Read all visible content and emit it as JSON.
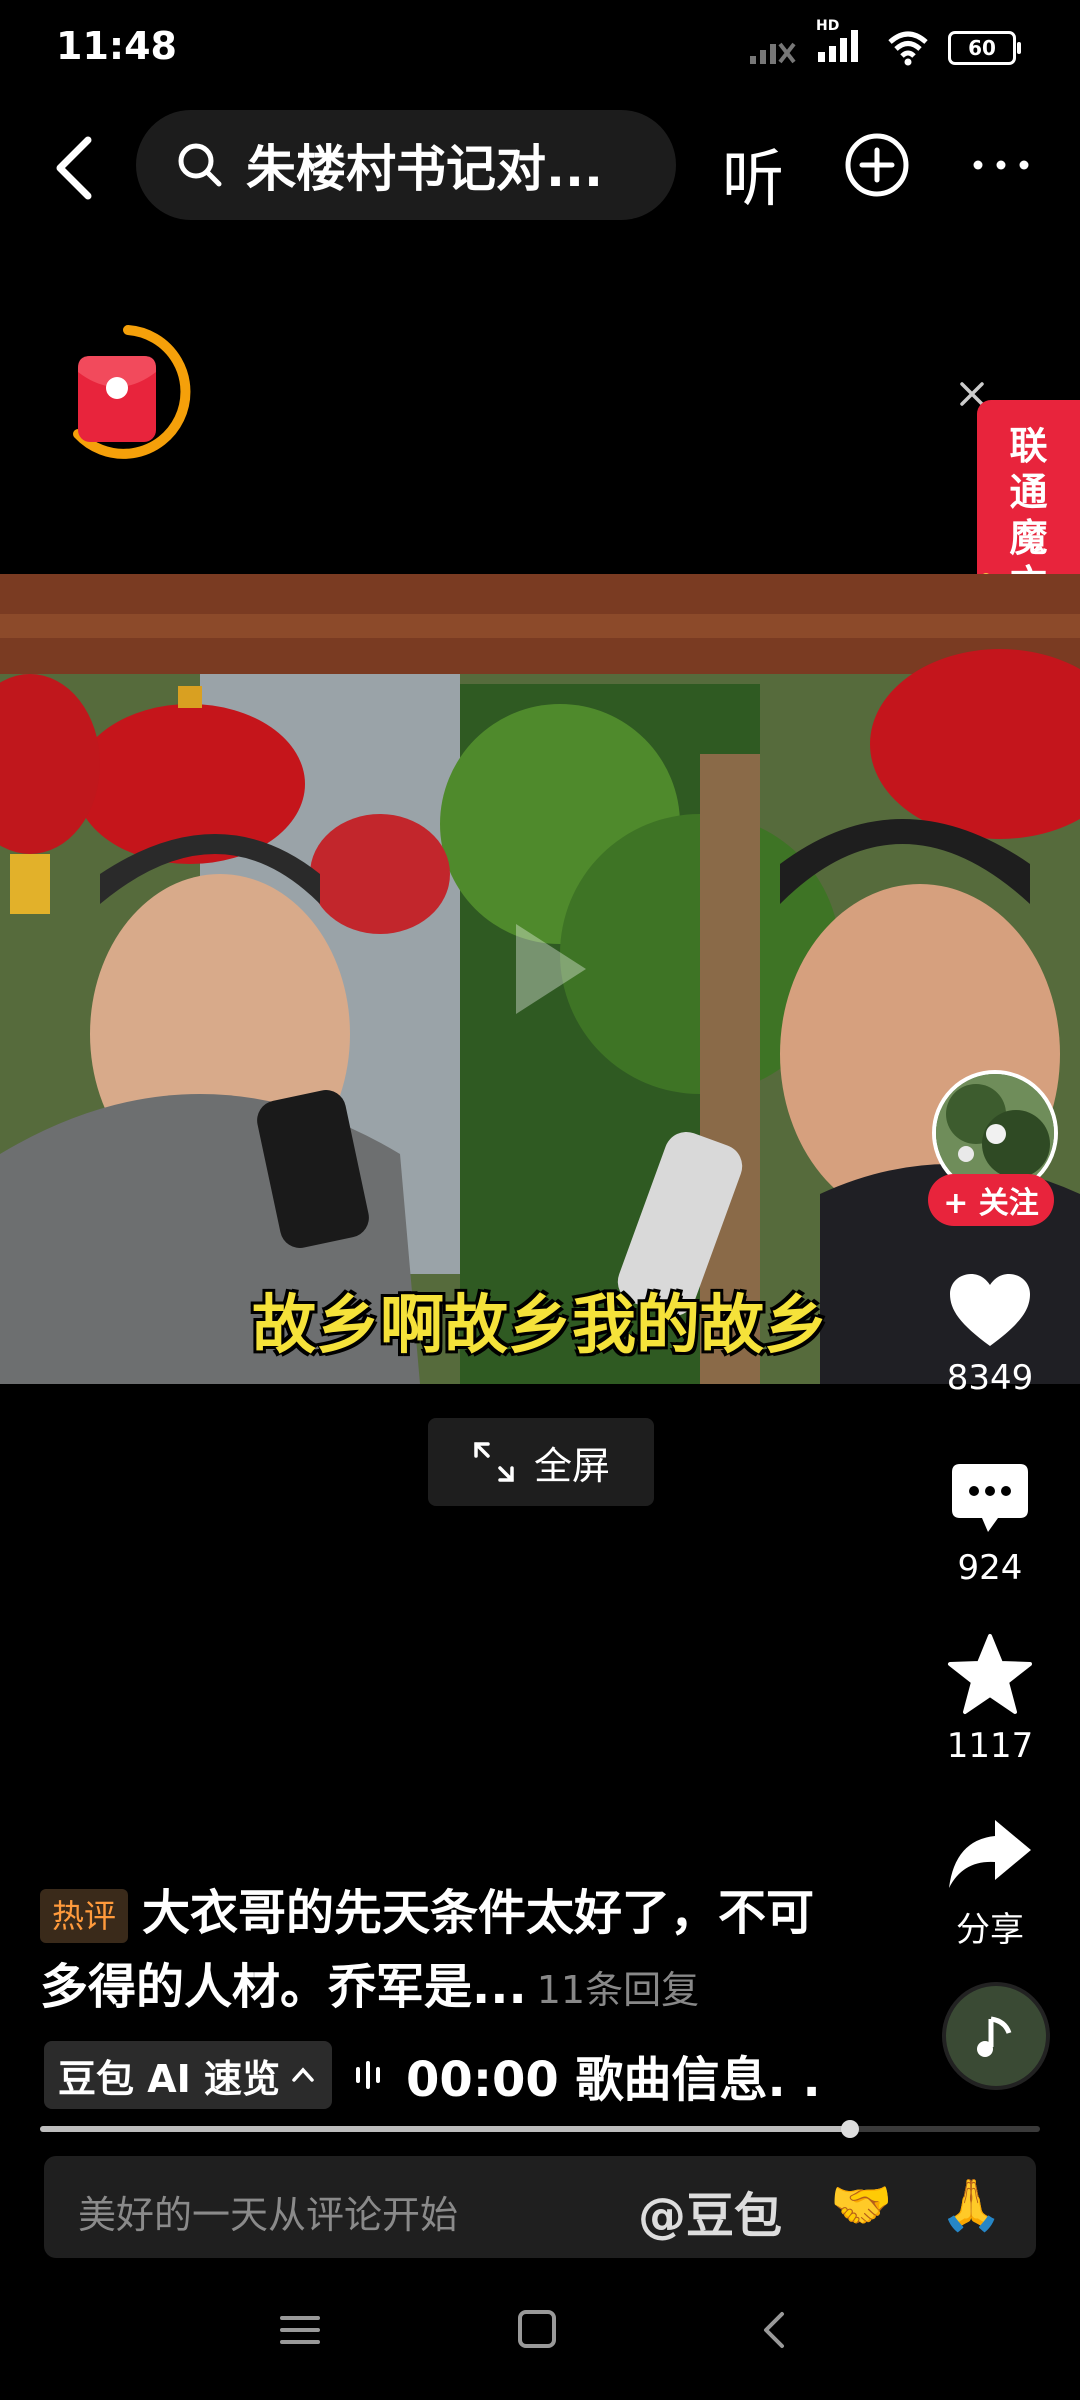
{
  "status_bar": {
    "time": "11:48",
    "battery": "60",
    "network_label": "HD"
  },
  "top_bar": {
    "search_query": "朱楼村书记对...",
    "listen_label": "听"
  },
  "ad": {
    "banner_chars": [
      "联",
      "通",
      "魔",
      "方"
    ]
  },
  "video": {
    "subtitle": "故乡啊故乡我的故乡"
  },
  "fullscreen_label": "全屏",
  "rail": {
    "follow_label": "+ 关注",
    "likes": "8349",
    "comments": "924",
    "favorites": "1117",
    "share_label": "分享"
  },
  "hot_comment": {
    "tag": "热评",
    "text": "大衣哥的先天条件太好了，不可多得的人材。乔军是...",
    "replies": "11条回复"
  },
  "ai_row": {
    "chip_label": "豆包 AI 速览",
    "song_text": "00:00 歌曲信息. ."
  },
  "progress": {
    "value": 0.81
  },
  "comment_bar": {
    "placeholder": "美好的一天从评论开始",
    "at_label": "@豆包",
    "emojis": [
      "🤝",
      "🙏"
    ]
  },
  "icons": {
    "back": "chevron-left-icon",
    "search": "search-icon",
    "add": "plus-circle-icon",
    "more": "more-dots-icon",
    "like": "heart-icon",
    "comment": "chat-bubble-icon",
    "favorite": "star-icon",
    "share": "share-arrow-icon"
  }
}
